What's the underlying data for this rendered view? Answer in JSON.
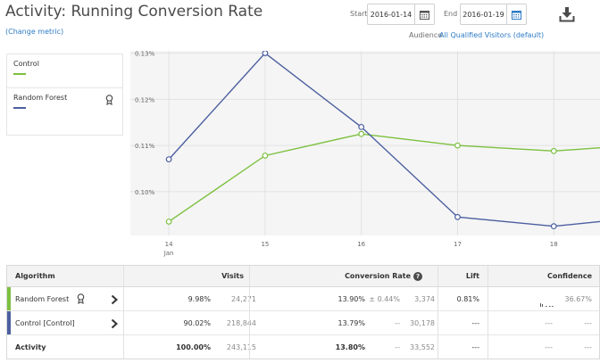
{
  "header": {
    "title": "Activity: Running Conversion Rate",
    "change_metric": "(Change metric)",
    "start_label": "Start",
    "start_value": "2016-01-14",
    "end_label": "End",
    "end_value": "2016-01-19",
    "audience_label": "Audience",
    "audience_value": "All Qualified Visitors (default)"
  },
  "legend": [
    {
      "name": "Control",
      "color": "#7cc03f"
    },
    {
      "name": "Random Forest",
      "color": "#4c5fa0",
      "winner": true
    }
  ],
  "chart_data": {
    "type": "line",
    "x": [
      14,
      15,
      16,
      17,
      18
    ],
    "x_tick_labels": [
      "14",
      "15",
      "16",
      "17",
      "18"
    ],
    "x_sublabel": "Jan",
    "y_ticks": [
      "0.13%",
      "0.12%",
      "0.11%",
      "0.10%"
    ],
    "ylim": [
      0.0905,
      0.1305
    ],
    "xlim": [
      13.6,
      18.48
    ],
    "series": [
      {
        "name": "Control",
        "color": "#7cc03f",
        "values": [
          0.0935,
          0.1078,
          0.1125,
          0.11,
          0.1088
        ],
        "extend": 0.1095
      },
      {
        "name": "Random Forest",
        "color": "#4c5fa0",
        "values": [
          0.107,
          0.13,
          0.114,
          0.0945,
          0.0925
        ],
        "extend": 0.0935
      }
    ]
  },
  "table": {
    "headers": {
      "algorithm": "Algorithm",
      "visits": "Visits",
      "conversion": "Conversion Rate",
      "lift": "Lift",
      "confidence": "Confidence"
    },
    "rows": [
      {
        "name": "Random Forest",
        "color": "#7cc03f",
        "visits_pct": "9.98%",
        "visits": "24,271",
        "cr": "13.90%",
        "cr_interval": "± 0.44%",
        "conversions": "3,374",
        "lift": "0.81%",
        "lift_interval": "",
        "confidence": "36.67%",
        "winner": true
      },
      {
        "name": "Control [Control]",
        "color": "#4c5fa0",
        "visits_pct": "90.02%",
        "visits": "218,844",
        "cr": "13.79%",
        "cr_interval": "--",
        "conversions": "30,178",
        "lift": "---",
        "lift_interval": "---",
        "confidence": "---"
      }
    ],
    "total": {
      "name": "Activity",
      "visits_pct": "100.00%",
      "visits": "243,115",
      "cr": "13.80%",
      "cr_interval": "--",
      "conversions": "33,552",
      "lift": "---",
      "lift_interval": "---",
      "confidence": "---"
    }
  }
}
